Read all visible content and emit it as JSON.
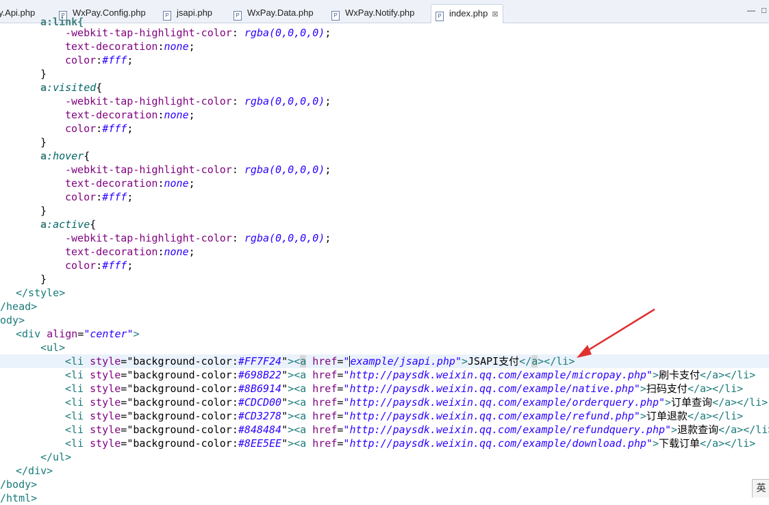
{
  "tabs": [
    {
      "label": "y.Api.php"
    },
    {
      "label": "WxPay.Config.php"
    },
    {
      "label": "jsapi.php"
    },
    {
      "label": "WxPay.Data.php"
    },
    {
      "label": "WxPay.Notify.php"
    },
    {
      "label": "index.php",
      "active": true
    }
  ],
  "close_glyph": "⊠",
  "window_controls": {
    "minimize": "—",
    "maximize": "□"
  },
  "ime_indicator": "英",
  "css": {
    "top_partial": "a:link{",
    "tap_prop": "-webkit-tap-highlight-color",
    "tap_val": "rgba(0,0,0,0)",
    "deco_prop": "text-decoration",
    "deco_val": "none",
    "color_prop": "color",
    "color_val": "#fff",
    "pseudos": [
      "visited",
      "hover",
      "active"
    ],
    "selector_a": "a",
    "open_brace": "{",
    "close_brace": "}"
  },
  "markup": {
    "style_close": "</style>",
    "head_close": "/head>",
    "body_open": "ody>",
    "div_open_tag": "<div",
    "div_attr": "align",
    "div_val": "\"center\"",
    "ul_open": "<ul>",
    "ul_close": "</ul>",
    "div_close": "</div>",
    "body_close": "/body>",
    "html_close_partial": "/html>"
  },
  "list_items": [
    {
      "color": "#FF7F24",
      "href": "example/jsapi.php",
      "text": "JSAPI支付"
    },
    {
      "color": "#698B22",
      "href": "http://paysdk.weixin.qq.com/example/micropay.php",
      "text": "刷卡支付"
    },
    {
      "color": "#8B6914",
      "href": "http://paysdk.weixin.qq.com/example/native.php",
      "text": "扫码支付"
    },
    {
      "color": "#CDCD00",
      "href": "http://paysdk.weixin.qq.com/example/orderquery.php",
      "text": "订单查询"
    },
    {
      "color": "#CD3278",
      "href": "http://paysdk.weixin.qq.com/example/refund.php",
      "text": "订单退款"
    },
    {
      "color": "#848484",
      "href": "http://paysdk.weixin.qq.com/example/refundquery.php",
      "text": "退款查询"
    },
    {
      "color": "#8EE5EE",
      "href": "http://paysdk.weixin.qq.com/example/download.php",
      "text": "下载订单"
    }
  ],
  "accent_colors": {
    "arrow": "#e03030",
    "current_line": "#eaf2fc"
  }
}
